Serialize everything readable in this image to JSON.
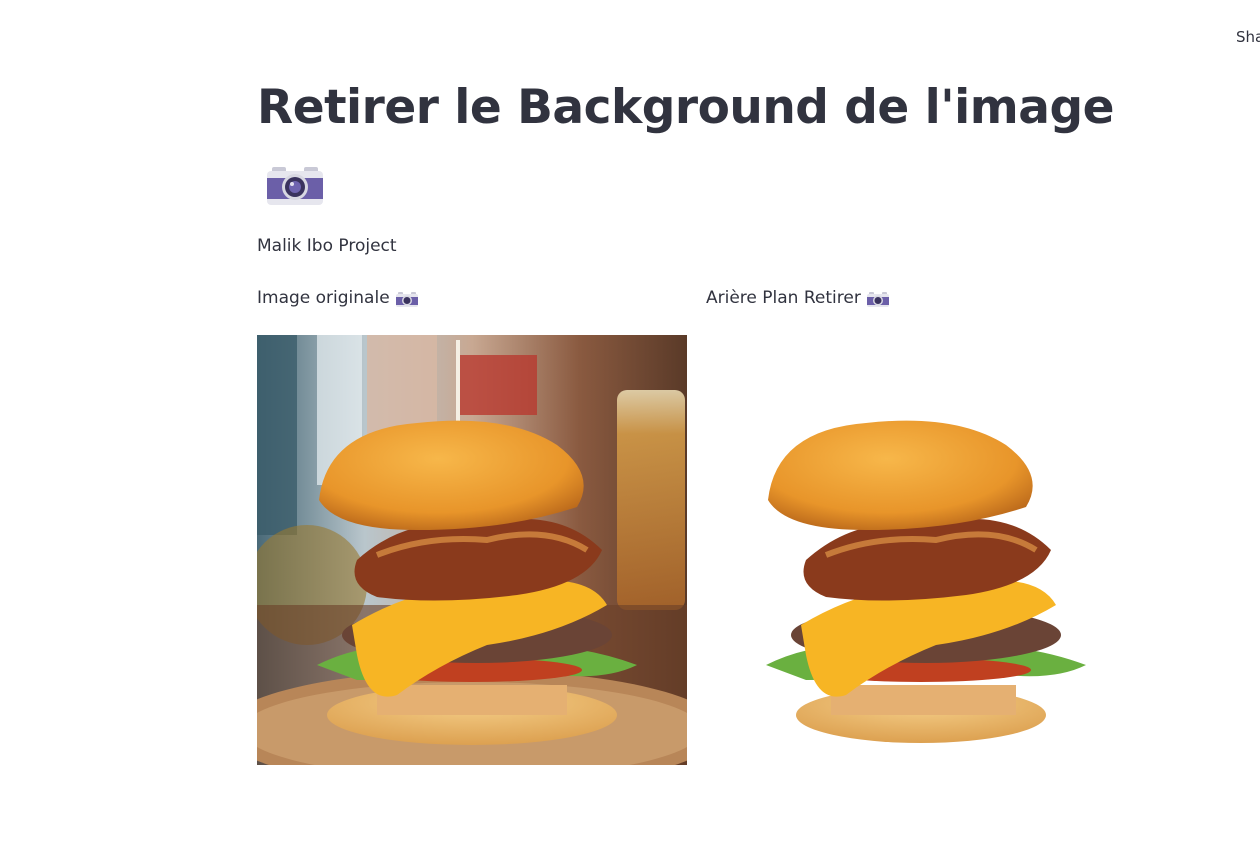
{
  "header": {
    "share_label": "Share"
  },
  "main": {
    "title": "Retirer le Background de l'image",
    "title_icon": "camera-icon",
    "author": "Malik Ibo Project",
    "columns": [
      {
        "label": "Image originale",
        "icon": "camera-icon"
      },
      {
        "label": "Arière Plan Retirer",
        "icon": "camera-icon"
      }
    ]
  },
  "colors": {
    "text": "#31333f",
    "background": "#ffffff",
    "camera_body": "#6b5fa8"
  }
}
